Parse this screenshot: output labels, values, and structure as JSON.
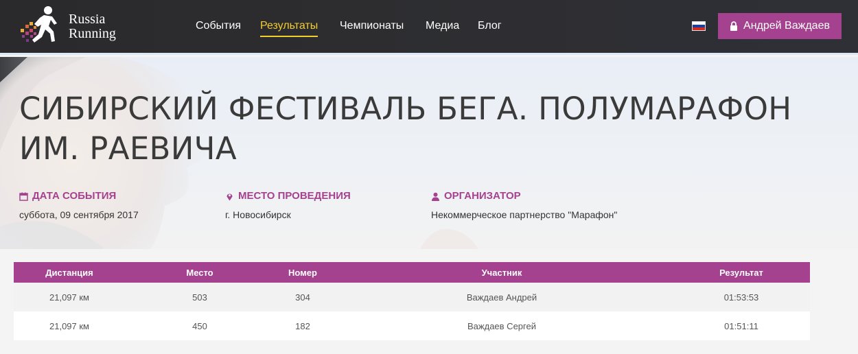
{
  "header": {
    "logo": {
      "line1": "Russia",
      "line2": "Running"
    },
    "nav": [
      {
        "label": "События",
        "active": false
      },
      {
        "label": "Результаты",
        "active": true
      },
      {
        "label": "Чемпионаты",
        "active": false
      },
      {
        "label": "Медиа",
        "active": false
      },
      {
        "label": "Блог",
        "active": false
      }
    ],
    "language_icon": "russia-flag-icon",
    "user_button": {
      "label": "Андрей Важдаев",
      "icon": "lock-icon"
    }
  },
  "event": {
    "title": "Сибирский фестиваль бега. Полумарафон им. Раевича",
    "date": {
      "icon": "calendar-icon",
      "label": "ДАТА СОБЫТИЯ",
      "value": "суббота, 09 сентября 2017"
    },
    "location": {
      "icon": "map-marker-icon",
      "label": "МЕСТО ПРОВЕДЕНИЯ",
      "value": "г. Новосибирск"
    },
    "organizer": {
      "icon": "user-icon",
      "label": "ОРГАНИЗАТОР",
      "value": "Некоммерческое партнерство \"Марафон\""
    }
  },
  "results": {
    "columns": [
      "Дистанция",
      "Место",
      "Номер",
      "Участник",
      "Результат"
    ],
    "rows": [
      {
        "distance": "21,097 км",
        "place": "503",
        "number": "304",
        "participant": "Важдаев Андрей",
        "result": "01:53:53"
      },
      {
        "distance": "21,097 км",
        "place": "450",
        "number": "182",
        "participant": "Важдаев Сергей",
        "result": "01:51:11"
      }
    ]
  },
  "colors": {
    "accent": "#a5428f",
    "nav_active": "#f3cd30",
    "header_bg": "#2d2d30"
  }
}
